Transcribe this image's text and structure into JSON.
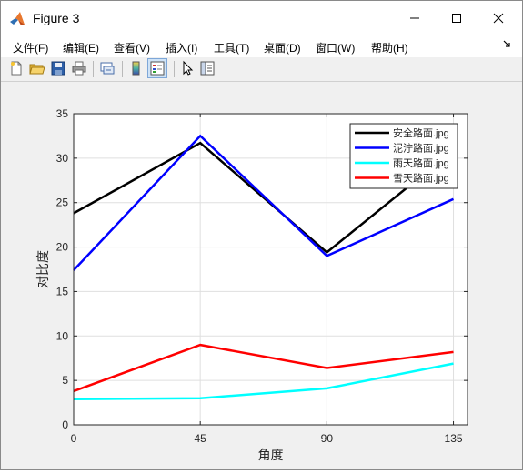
{
  "window": {
    "title": "Figure 3",
    "controls": {
      "minimize": "—",
      "maximize": "☐",
      "close": "✕"
    }
  },
  "menubar": {
    "items": [
      {
        "label": "文件(F)"
      },
      {
        "label": "编辑(E)"
      },
      {
        "label": "查看(V)"
      },
      {
        "label": "插入(I)"
      },
      {
        "label": "工具(T)"
      },
      {
        "label": "桌面(D)"
      },
      {
        "label": "窗口(W)"
      },
      {
        "label": "帮助(H)"
      }
    ],
    "overflow_icon": "dock-arrow-icon"
  },
  "toolbar": {
    "icons": [
      "new-figure-icon",
      "open-file-icon",
      "save-icon",
      "print-icon",
      "link-plot-icon",
      "colorbar-icon",
      "legend-icon",
      "pointer-icon",
      "property-editor-icon"
    ]
  },
  "chart_data": {
    "type": "line",
    "x": [
      0,
      45,
      90,
      135
    ],
    "xlabel": "角度",
    "ylabel": "对比度",
    "xlim": [
      0,
      140
    ],
    "ylim": [
      0,
      35
    ],
    "xticks": [
      0,
      45,
      90,
      135
    ],
    "yticks": [
      0,
      5,
      10,
      15,
      20,
      25,
      30,
      35
    ],
    "grid": true,
    "legend_position": "top-right",
    "series": [
      {
        "name": "安全路面.jpg",
        "color": "#000000",
        "values": [
          23.8,
          31.7,
          19.4,
          30.9
        ]
      },
      {
        "name": "泥泞路面.jpg",
        "color": "#0000ff",
        "values": [
          17.4,
          32.5,
          19.0,
          25.4
        ]
      },
      {
        "name": "雨天路面.jpg",
        "color": "#00ffff",
        "values": [
          2.9,
          3.0,
          4.1,
          6.9
        ]
      },
      {
        "name": "雪天路面.jpg",
        "color": "#ff0000",
        "values": [
          3.8,
          9.0,
          6.4,
          8.2
        ]
      }
    ]
  }
}
